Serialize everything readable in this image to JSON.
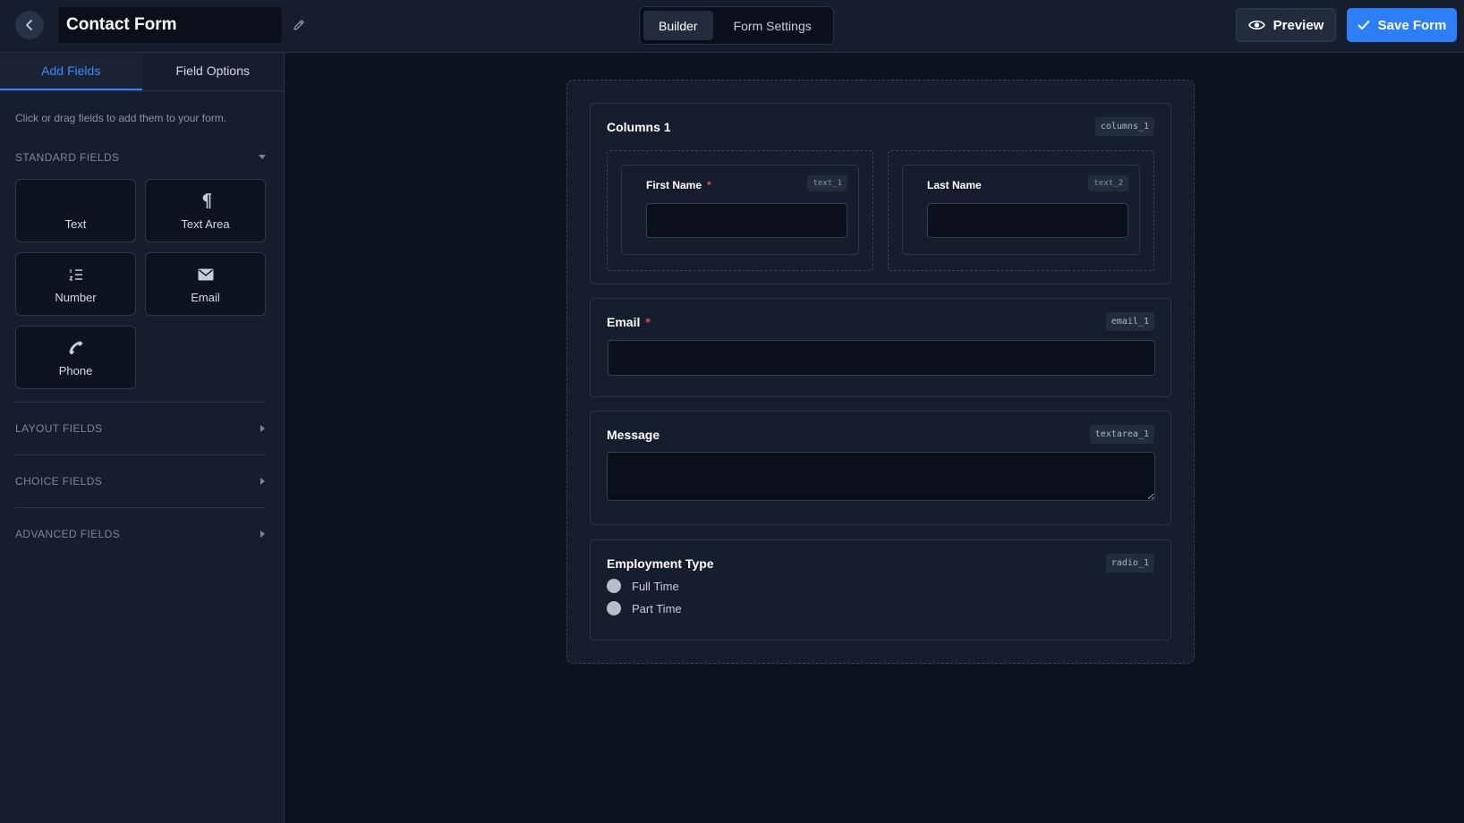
{
  "header": {
    "form_title": "Contact Form",
    "modes": [
      "Builder",
      "Form Settings"
    ],
    "preview_label": "Preview",
    "save_label": "Save Form"
  },
  "sidebar": {
    "tabs": [
      "Add Fields",
      "Field Options"
    ],
    "hint": "Click or drag fields to add them to your form.",
    "groups": [
      {
        "title": "STANDARD FIELDS",
        "expanded": true
      },
      {
        "title": "LAYOUT FIELDS",
        "expanded": false
      },
      {
        "title": "CHOICE FIELDS",
        "expanded": false
      },
      {
        "title": "ADVANCED FIELDS",
        "expanded": false
      }
    ],
    "standard_fields": [
      {
        "label": "Text",
        "icon": "text-icon"
      },
      {
        "label": "Text Area",
        "icon": "pilcrow-icon"
      },
      {
        "label": "Number",
        "icon": "numbered-list-icon"
      },
      {
        "label": "Email",
        "icon": "envelope-icon"
      },
      {
        "label": "Phone",
        "icon": "phone-icon"
      }
    ]
  },
  "form": {
    "columns": {
      "title": "Columns 1",
      "key": "columns_1",
      "fields": [
        {
          "label": "First Name",
          "required": "*",
          "key": "text_1"
        },
        {
          "label": "Last Name",
          "key": "text_2"
        }
      ]
    },
    "email": {
      "label": "Email",
      "required": "*",
      "key": "email_1"
    },
    "message": {
      "label": "Message",
      "key": "textarea_1"
    },
    "employment": {
      "label": "Employment Type",
      "key": "radio_1",
      "options": [
        "Full Time",
        "Part Time"
      ]
    }
  },
  "colors": {
    "accent": "#2d7ff9",
    "background": "#0e1320",
    "panel": "#161d2c",
    "required": "#ef4444"
  }
}
